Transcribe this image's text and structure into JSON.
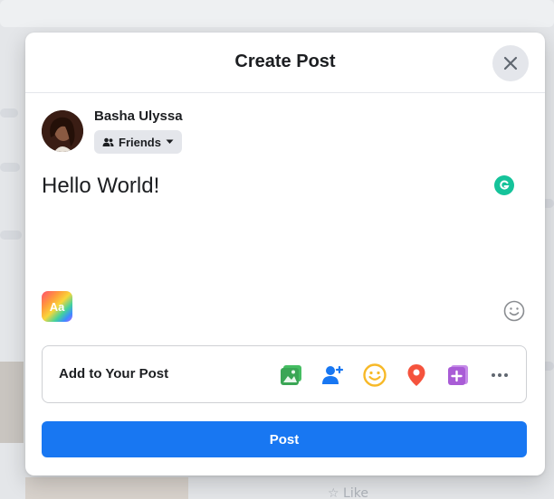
{
  "background": {
    "like_label": "Like"
  },
  "modal": {
    "title": "Create Post"
  },
  "author": {
    "name": "Basha Ulyssa",
    "audience_label": "Friends"
  },
  "composer": {
    "text": "Hello World!",
    "background_picker_label": "Aa"
  },
  "add_to_post": {
    "label": "Add to Your Post",
    "icons": [
      "photo-video-icon",
      "tag-people-icon",
      "feeling-icon",
      "check-in-icon",
      "gif-icon",
      "more-icon"
    ]
  },
  "post_button_label": "Post",
  "colors": {
    "primary": "#1877f2",
    "photo": "#45bd62",
    "tag": "#1877f2",
    "feeling": "#f7b928",
    "location": "#f5533d",
    "gif": "#a95cd6",
    "grammarly": "#15c39a"
  }
}
